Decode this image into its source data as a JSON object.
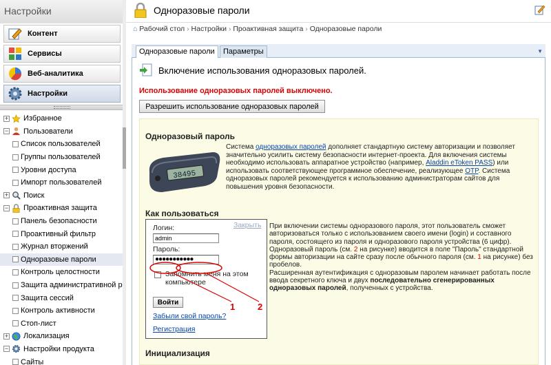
{
  "sidebar": {
    "title": "Настройки",
    "buttons": [
      {
        "label": "Контент",
        "icon": "pencil-icon"
      },
      {
        "label": "Сервисы",
        "icon": "services-icon"
      },
      {
        "label": "Веб-аналитика",
        "icon": "chart-icon"
      },
      {
        "label": "Настройки",
        "icon": "gear-icon"
      }
    ],
    "tree": [
      {
        "label": "Избранное",
        "toggle": "+",
        "icon": "star-icon"
      },
      {
        "label": "Пользователи",
        "toggle": "−",
        "icon": "users-icon"
      },
      {
        "label": "Список пользователей"
      },
      {
        "label": "Группы пользователей"
      },
      {
        "label": "Уровни доступа"
      },
      {
        "label": "Импорт пользователей"
      },
      {
        "label": "Поиск",
        "toggle": "+",
        "icon": "search-icon"
      },
      {
        "label": "Проактивная защита",
        "toggle": "−",
        "icon": "lock-icon"
      },
      {
        "label": "Панель безопасности"
      },
      {
        "label": "Проактивный фильтр"
      },
      {
        "label": "Журнал вторжений"
      },
      {
        "label": "Одноразовые пароли"
      },
      {
        "label": "Контроль целостности"
      },
      {
        "label": "Защита административной разд"
      },
      {
        "label": "Защита сессий"
      },
      {
        "label": "Контроль активности"
      },
      {
        "label": "Стоп-лист"
      },
      {
        "label": "Локализация",
        "toggle": "+",
        "icon": "globe-icon"
      },
      {
        "label": "Настройки продукта",
        "toggle": "−",
        "icon": "gear-icon"
      },
      {
        "label": "Сайты"
      }
    ]
  },
  "page": {
    "title": "Одноразовые пароли",
    "breadcrumb": {
      "home": "Рабочий стол",
      "c1": "Настройки",
      "c2": "Проактивная защита",
      "c3": "Одноразовые пароли",
      "sep": "›"
    },
    "tabs": [
      "Одноразовые пароли",
      "Параметры"
    ],
    "section_title": "Включение использования одноразовых паролей.",
    "warning": "Использование одноразовых паролей выключено.",
    "enable_button": "Разрешить использование одноразовых паролей"
  },
  "info": {
    "otp_heading": "Одноразовый пароль",
    "device_display": "38495",
    "desc": {
      "p1": "Система ",
      "l1": "одноразовых паролей",
      "p2": " дополняет стандартную систему авторизации и позволяет значительно усилить систему безопасности интернет-проекта. Для включения системы необходимо использовать аппаратное устройство (например, ",
      "l2": "Aladdin eToken PASS",
      "p3": ") или использовать соответствующее программное обеспечение, реализующее ",
      "l3": "OTP",
      "p4": ". Система одноразовых паролей рекомендуется к использованию администраторам сайтов для повышения уровня безопасности."
    },
    "how_heading": "Как пользоваться",
    "login": {
      "login_label": "Логин:",
      "close_link": "Закрыть",
      "login_value": "admin",
      "password_label": "Пароль:",
      "password_value": "●●●●●●●●●●●",
      "remember": "Запомнить меня на этом компьютере",
      "submit": "Войти",
      "forgot": "Забыли свой пароль?",
      "register": "Регистрация",
      "marker1": "1",
      "marker2": "2"
    },
    "how": {
      "t1": "При включении системы одноразового пароля, этот пользователь сможет авторизоваться только с использованием своего имени (login) и составного пароля, состоящего из пароля и одноразового пароля устройства (6 цифр). Одноразовый пароль (см. ",
      "n2": "2",
      "t2": " на рисунке) вводится в поле \"Пароль\" стандартной формы авторизации на сайте сразу после обычного пароля (см. ",
      "n1": "1",
      "t3": " на рисунке) без пробелов.",
      "t4": "Расширенная аутентификация с одноразовым паролем начинает работать после ввода секретного ключа и двух ",
      "b1": "последовательно сгенерированных одноразовых паролей",
      "t5": ", полученных с устройства."
    },
    "init_heading": "Инициализация"
  }
}
